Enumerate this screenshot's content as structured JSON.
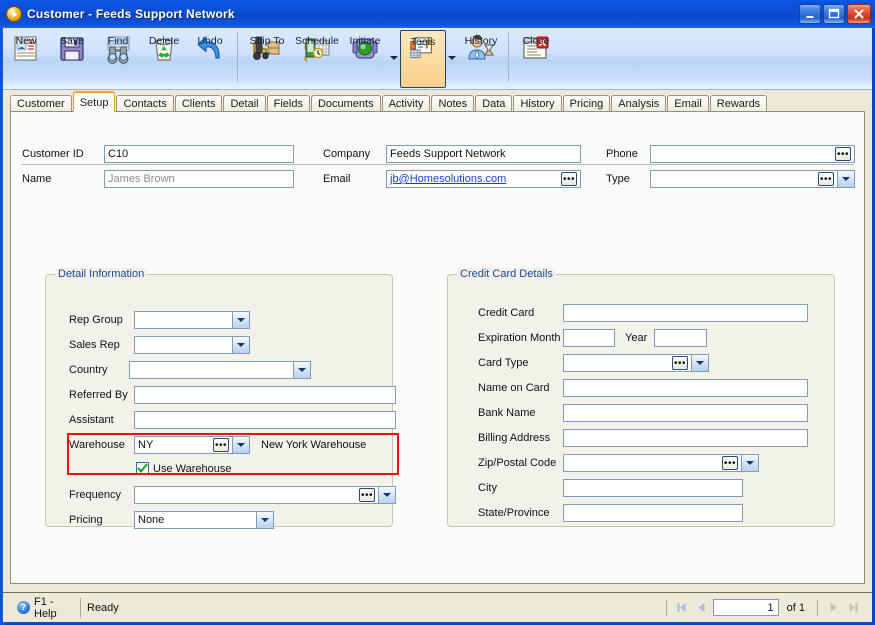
{
  "window": {
    "title": "Customer  -  Feeds Support Network",
    "icon": "play-circle-icon",
    "buttons": [
      {
        "name": "minimize-button",
        "label": "_"
      },
      {
        "name": "maximize-button",
        "label": "□"
      },
      {
        "name": "close-button",
        "label": "×"
      }
    ]
  },
  "toolbar": {
    "items": [
      {
        "name": "new-button",
        "label": "New",
        "icon": "new-record-icon",
        "selected": false,
        "dropdown": false
      },
      {
        "name": "save-button",
        "label": "Save",
        "icon": "floppy-disk-icon",
        "selected": false,
        "dropdown": false
      },
      {
        "name": "find-button",
        "label": "Find",
        "icon": "binoculars-icon",
        "selected": false,
        "dropdown": false
      },
      {
        "name": "delete-button",
        "label": "Delete",
        "icon": "recycle-bin-icon",
        "selected": false,
        "dropdown": false
      },
      {
        "name": "undo-button",
        "label": "Undo",
        "icon": "undo-arrow-icon",
        "selected": false,
        "dropdown": false
      },
      {
        "name": "ship-to-button",
        "label": "Ship To",
        "icon": "forklift-icon",
        "selected": false,
        "dropdown": false
      },
      {
        "name": "schedule-button",
        "label": "Schedule",
        "icon": "calendar-clock-icon",
        "selected": false,
        "dropdown": false
      },
      {
        "name": "initiate-button",
        "label": "Initiate",
        "icon": "traffic-light-icon",
        "selected": false,
        "dropdown": true
      },
      {
        "name": "tools-button",
        "label": "Tools",
        "icon": "tools-document-icon",
        "selected": true,
        "dropdown": true
      },
      {
        "name": "history-button",
        "label": "History",
        "icon": "person-hourglass-icon",
        "selected": false,
        "dropdown": false
      },
      {
        "name": "close-button",
        "label": "Close",
        "icon": "close-window-icon",
        "selected": false,
        "dropdown": false
      }
    ]
  },
  "tabs": [
    {
      "name": "tab-customer",
      "label": "Customer",
      "active": false
    },
    {
      "name": "tab-setup",
      "label": "Setup",
      "active": true
    },
    {
      "name": "tab-contacts",
      "label": "Contacts",
      "active": false
    },
    {
      "name": "tab-clients",
      "label": "Clients",
      "active": false
    },
    {
      "name": "tab-detail",
      "label": "Detail",
      "active": false
    },
    {
      "name": "tab-fields",
      "label": "Fields",
      "active": false
    },
    {
      "name": "tab-documents",
      "label": "Documents",
      "active": false
    },
    {
      "name": "tab-activity",
      "label": "Activity",
      "active": false
    },
    {
      "name": "tab-notes",
      "label": "Notes",
      "active": false
    },
    {
      "name": "tab-data",
      "label": "Data",
      "active": false
    },
    {
      "name": "tab-history",
      "label": "History",
      "active": false
    },
    {
      "name": "tab-pricing",
      "label": "Pricing",
      "active": false
    },
    {
      "name": "tab-analysis",
      "label": "Analysis",
      "active": false
    },
    {
      "name": "tab-email",
      "label": "Email",
      "active": false
    },
    {
      "name": "tab-rewards",
      "label": "Rewards",
      "active": false
    }
  ],
  "header": {
    "customer_id_label": "Customer ID",
    "customer_id_value": "C10",
    "name_label": "Name",
    "name_value": "James Brown",
    "company_label": "Company",
    "company_value": "Feeds Support Network",
    "email_label": "Email",
    "email_value": "jb@Homesolutions.com",
    "phone_label": "Phone",
    "phone_value": "",
    "type_label": "Type",
    "type_value": "",
    "ellipsis": "•••"
  },
  "detail_group": {
    "title": "Detail Information",
    "rep_group_label": "Rep Group",
    "rep_group_value": "",
    "sales_rep_label": "Sales Rep",
    "sales_rep_value": "",
    "country_label": "Country",
    "country_value": "",
    "referred_by_label": "Referred By",
    "referred_by_value": "",
    "assistant_label": "Assistant",
    "assistant_value": "",
    "warehouse_label": "Warehouse",
    "warehouse_value": "NY",
    "warehouse_description": "New York Warehouse",
    "use_warehouse_label": "Use Warehouse",
    "use_warehouse_checked": true,
    "frequency_label": "Frequency",
    "frequency_value": "",
    "pricing_label": "Pricing",
    "pricing_value": "None"
  },
  "credit_card_group": {
    "title": "Credit Card Details",
    "credit_card_label": "Credit Card",
    "credit_card_value": "",
    "expiration_month_label": "Expiration Month",
    "expiration_month_value": "",
    "year_label": "Year",
    "year_value": "",
    "card_type_label": "Card Type",
    "card_type_value": "",
    "name_on_card_label": "Name on Card",
    "name_on_card_value": "",
    "bank_name_label": "Bank Name",
    "bank_name_value": "",
    "billing_address_label": "Billing Address",
    "billing_address_value": "",
    "zip_label": "Zip/Postal Code",
    "zip_value": "",
    "city_label": "City",
    "city_value": "",
    "state_label": "State/Province",
    "state_value": ""
  },
  "statusbar": {
    "help_label": "F1 - Help",
    "help_icon": "question-circle-icon",
    "state": "Ready",
    "nav": {
      "first_icon": "first-record-icon",
      "prev_icon": "previous-record-icon",
      "current_page": "1",
      "of_label": "of  1",
      "next_icon": "next-record-icon",
      "last_icon": "last-record-icon"
    }
  },
  "colors": {
    "title_bar": "#0a47c8",
    "highlight_box": "#ee1111",
    "group_title": "#18469c",
    "link": "#1a3fd0",
    "active_tab_accent": "#f0a628"
  }
}
